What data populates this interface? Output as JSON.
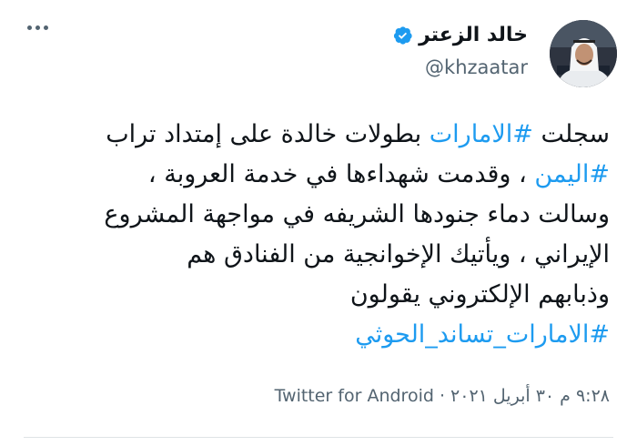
{
  "author": {
    "display_name": "خالد الزعتر",
    "handle": "@khzaatar",
    "verified": true,
    "avatar_icon": "profile-photo",
    "verified_icon": "verified-badge-icon",
    "accent": "#1d9bf0"
  },
  "tweet": {
    "lines": [
      [
        {
          "text": "سجلت ",
          "type": "text"
        },
        {
          "text": "#الامارات",
          "type": "hashtag"
        },
        {
          "text": " بطولات خالدة على إمتداد تراب",
          "type": "text"
        }
      ],
      [
        {
          "text": "#اليمن",
          "type": "hashtag"
        },
        {
          "text": " ، وقدمت شهداءها في خدمة العروبة ،",
          "type": "text"
        }
      ],
      [
        {
          "text": "وسالت دماء جنودها الشريفه في مواجهة المشروع",
          "type": "text"
        }
      ],
      [
        {
          "text": "الإيراني ، ويأتيك الإخوانجية من الفنادق هم",
          "type": "text"
        }
      ],
      [
        {
          "text": "وذبابهم الإلكتروني يقولون",
          "type": "text"
        }
      ],
      [
        {
          "text": "#الامارات_تساند_الحوثي",
          "type": "hashtag"
        }
      ]
    ]
  },
  "meta": {
    "time": "٩:٢٨ م",
    "separator": "·",
    "date": "٣٠ أبريل ٢٠٢١",
    "source": "Twitter for Android"
  },
  "colors": {
    "text": "#0f1419",
    "secondary": "#536471",
    "link": "#1d9bf0"
  }
}
